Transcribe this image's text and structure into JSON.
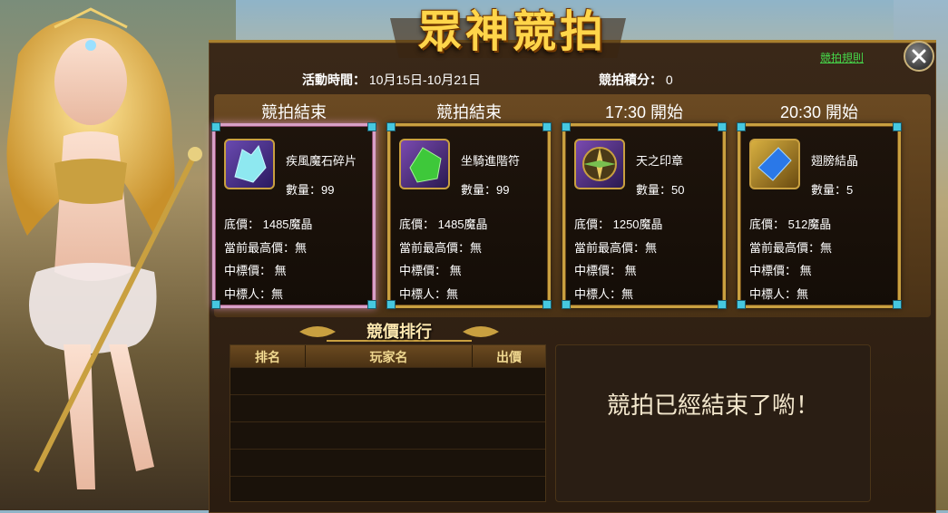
{
  "title": "眾神競拍",
  "rules_link": "競拍規則",
  "event": {
    "time_label": "活動時間：",
    "time_value": "10月15日-10月21日",
    "points_label": "競拍積分：",
    "points_value": "0"
  },
  "auctions": [
    {
      "status": "競拍結束",
      "name": "疾風魔石碎片",
      "quantity": "數量：99",
      "base_price": "底價：  1485魔晶",
      "current_highest": "當前最高價：無",
      "winning_price": "中標價：  無",
      "winner": "中標人：無",
      "icon": "crystal-shard-icon"
    },
    {
      "status": "競拍結束",
      "name": "坐騎進階符",
      "quantity": "數量：99",
      "base_price": "底價：  1485魔晶",
      "current_highest": "當前最高價：無",
      "winning_price": "中標價：  無",
      "winner": "中標人：無",
      "icon": "green-gem-icon"
    },
    {
      "status": "17:30 開始",
      "name": "天之印章",
      "quantity": "數量：50",
      "base_price": "底價：  1250魔晶",
      "current_highest": "當前最高價：無",
      "winning_price": "中標價：  無",
      "winner": "中標人：無",
      "icon": "compass-seal-icon"
    },
    {
      "status": "20:30 開始",
      "name": "翅膀結晶",
      "quantity": "數量：5",
      "base_price": "底價：  512魔晶",
      "current_highest": "當前最高價：無",
      "winning_price": "中標價：  無",
      "winner": "中標人：無",
      "icon": "blue-crystal-icon"
    }
  ],
  "ranking": {
    "title": "競價排行",
    "columns": [
      "排名",
      "玩家名",
      "出價"
    ],
    "rows": []
  },
  "message": "競拍已經結束了喲！",
  "colors": {
    "gold": "#c9a040",
    "title": "#ffd54a",
    "link": "#46d64a"
  }
}
